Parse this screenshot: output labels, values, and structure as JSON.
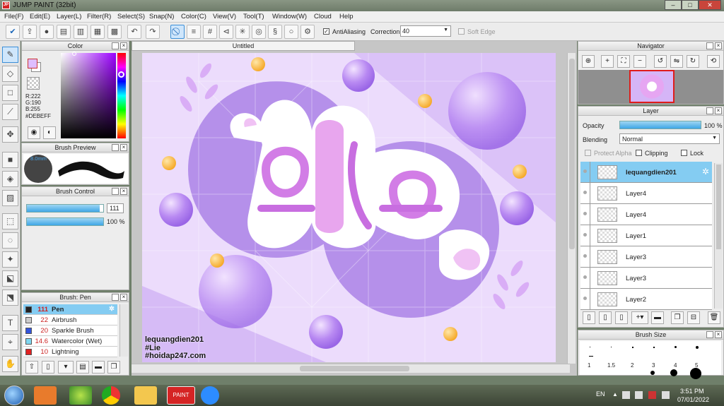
{
  "window": {
    "title": "JUMP PAINT (32bit)"
  },
  "menu": [
    "File(F)",
    "Edit(E)",
    "Layer(L)",
    "Filter(R)",
    "Select(S)",
    "Snap(N)",
    "Color(C)",
    "View(V)",
    "Tool(T)",
    "Window(W)",
    "Cloud",
    "Help"
  ],
  "toolbar": {
    "antialiasing_label": "AntiAliasing",
    "correction_label": "Correction",
    "correction_value": "40",
    "soft_edge_label": "Soft Edge"
  },
  "color_panel": {
    "title": "Color",
    "r": "R:222",
    "g": "G:190",
    "b": "B:255",
    "hex": "#DEBEFF",
    "fg_color": "#DEBEFF"
  },
  "brush_preview": {
    "title": "Brush Preview",
    "size_label": "8.0mm"
  },
  "brush_control": {
    "title": "Brush Control",
    "size_value": "111",
    "size_fraction": 0.95,
    "opacity_value": "100 %",
    "opacity_fraction": 1.0
  },
  "brush_list": {
    "title": "Brush: Pen",
    "items": [
      {
        "size": "111",
        "name": "Pen",
        "color": "#222222",
        "selected": true
      },
      {
        "size": "22",
        "name": "Airbrush",
        "color": "#cccccc",
        "selected": false
      },
      {
        "size": "20",
        "name": "Sparkle Brush",
        "color": "#3355dd",
        "selected": false
      },
      {
        "size": "14.6",
        "name": "Watercolor (Wet)",
        "color": "#7fd7f0",
        "selected": false
      },
      {
        "size": "10",
        "name": "Lightning",
        "color": "#e02222",
        "selected": false
      }
    ]
  },
  "document": {
    "tab_title": "Untitled",
    "watermark": [
      "lequangdien201",
      "#Lie",
      "#hoidap247.com"
    ]
  },
  "navigator": {
    "title": "Navigator"
  },
  "layer_panel": {
    "title": "Layer",
    "opacity_label": "Opacity",
    "opacity_value": "100 %",
    "opacity_fraction": 1.0,
    "blending_label": "Blending",
    "blending_value": "Normal",
    "protect_alpha": "Protect Alpha",
    "clipping": "Clipping",
    "lock": "Lock",
    "layers": [
      {
        "name": "lequangdien201",
        "selected": true
      },
      {
        "name": "Layer4",
        "selected": false
      },
      {
        "name": "Layer4",
        "selected": false
      },
      {
        "name": "Layer1",
        "selected": false
      },
      {
        "name": "Layer3",
        "selected": false
      },
      {
        "name": "Layer3",
        "selected": false
      },
      {
        "name": "Layer2",
        "selected": false
      }
    ]
  },
  "brush_size": {
    "title": "Brush Size",
    "sizes": [
      "1",
      "1.5",
      "2",
      "3",
      "4",
      "5"
    ]
  },
  "taskbar": {
    "lang": "EN",
    "time": "3:51 PM",
    "date": "07/01/2022"
  }
}
